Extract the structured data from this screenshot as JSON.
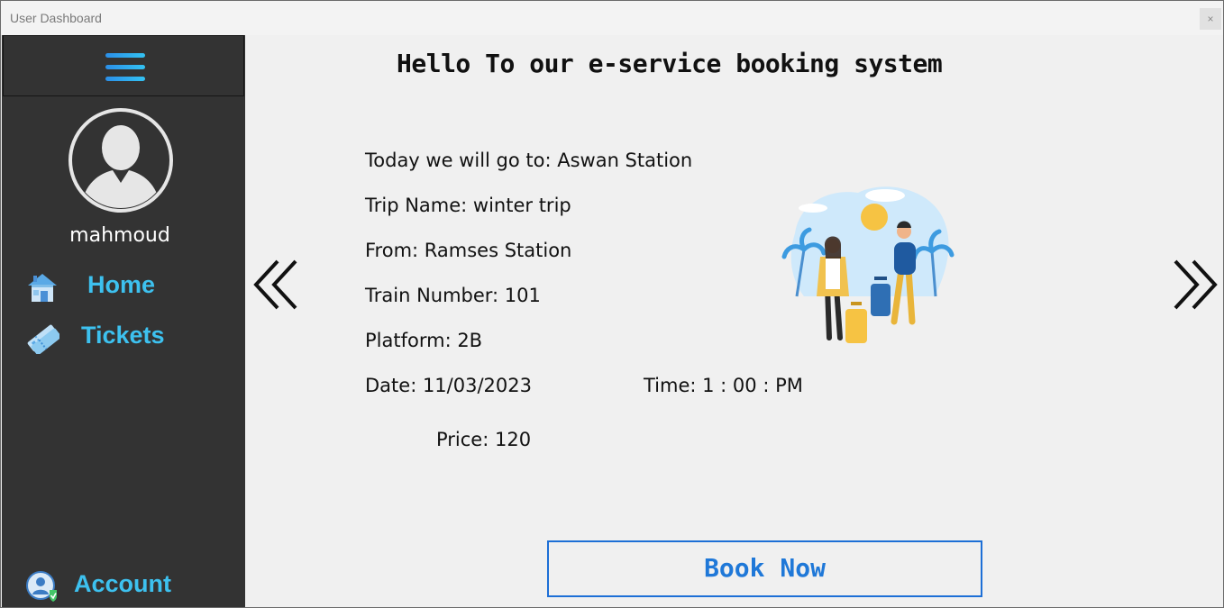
{
  "window": {
    "title": "User Dashboard",
    "close_label": "×"
  },
  "sidebar": {
    "username": "mahmoud",
    "items": [
      {
        "label": "Home",
        "icon": "home-icon"
      },
      {
        "label": "Tickets",
        "icon": "tickets-icon"
      },
      {
        "label": "Account",
        "icon": "account-icon"
      }
    ]
  },
  "main": {
    "heading": "Hello To our e-service booking system",
    "destination": "Today we will go to: Aswan Station",
    "trip_name": "Trip Name: winter trip",
    "from": "From: Ramses Station",
    "train_number": "Train Number: 101",
    "platform": "Platform: 2B",
    "date": "Date: 11/03/2023",
    "time": "Time: 1 : 00 : PM",
    "price": "Price: 120",
    "book_label": "Book Now"
  },
  "colors": {
    "accent": "#3dc1ef",
    "sidebar_bg": "#333333",
    "button_border": "#1d6fd6"
  }
}
